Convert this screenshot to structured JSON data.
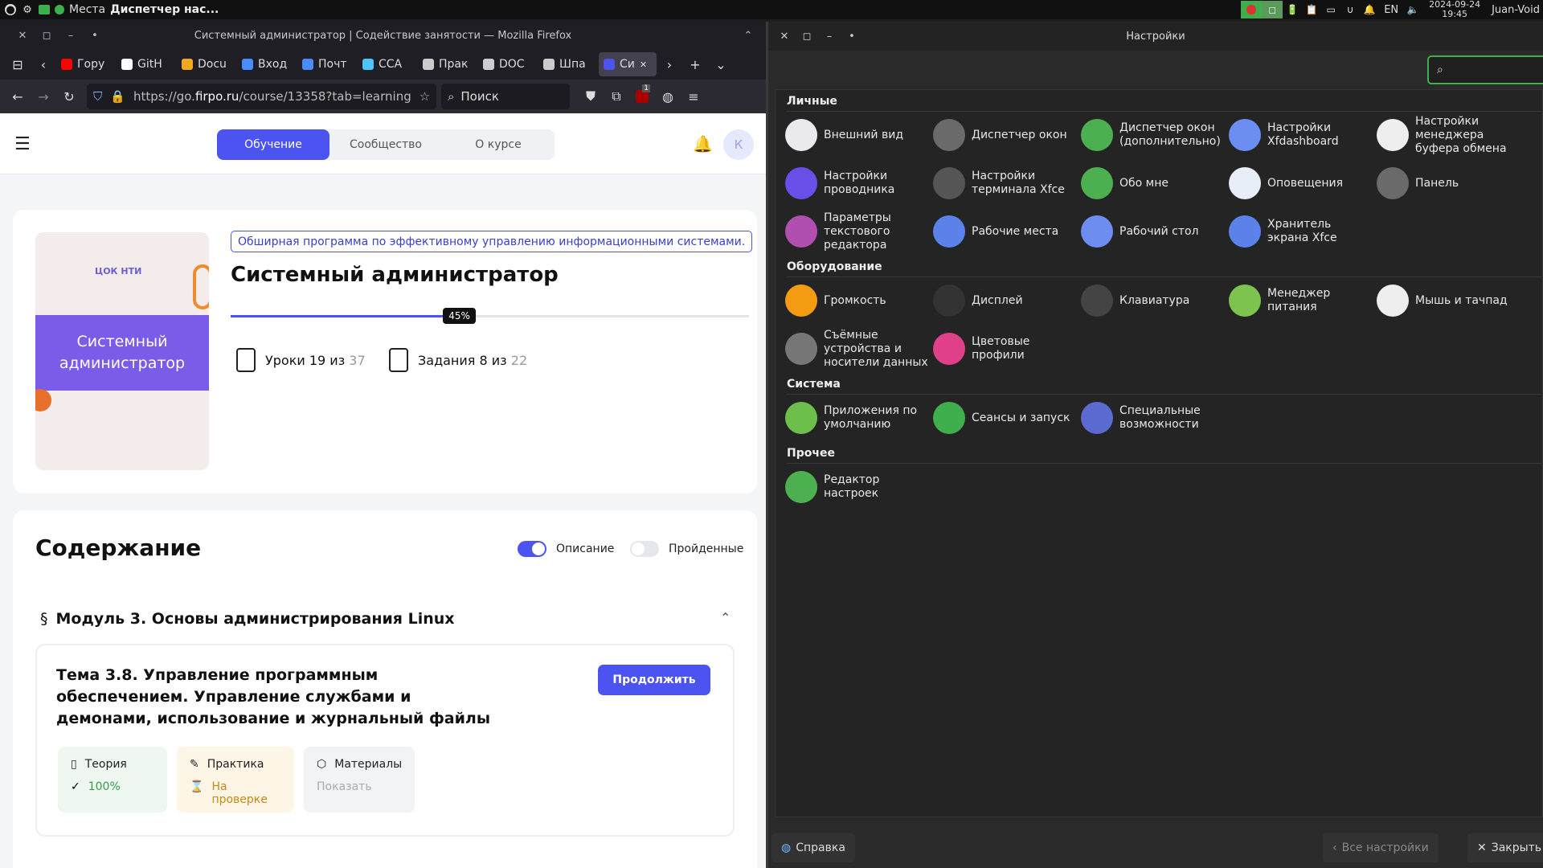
{
  "panel": {
    "places": "Места",
    "taskbar_item": "Диспетчер нас...",
    "lang": "EN",
    "date": "2024-09-24",
    "time": "19:45",
    "user": "Juan-Void"
  },
  "firefox": {
    "window_title": "Системный администратор | Содействие занятости — Mozilla Firefox",
    "tabs": [
      {
        "label": "Гору",
        "icon": "youtube-icon",
        "color": "#ff0000"
      },
      {
        "label": "GitH",
        "icon": "github-icon",
        "color": "#ffffff"
      },
      {
        "label": "Docu",
        "icon": "docs-icon",
        "color": "#f5a623"
      },
      {
        "label": "Вход",
        "icon": "mail-icon",
        "color": "#4a8cff"
      },
      {
        "label": "Почт",
        "icon": "mail-icon",
        "color": "#4a8cff"
      },
      {
        "label": "CCA",
        "icon": "network-icon",
        "color": "#4fc3f7"
      },
      {
        "label": "Прак",
        "icon": "page-icon",
        "color": "#cccccc"
      },
      {
        "label": "DOC",
        "icon": "page-icon",
        "color": "#cccccc"
      },
      {
        "label": "Шпа",
        "icon": "page-icon",
        "color": "#cccccc"
      },
      {
        "label": "Си",
        "icon": "course-icon",
        "color": "#4b53f1"
      }
    ],
    "url_prefix": "https://go.",
    "url_host": "firpo.ru",
    "url_path": "/course/13358?tab=learning",
    "search_placeholder": "Поиск",
    "ublock_badge": "1"
  },
  "page": {
    "nav_tabs": [
      "Обучение",
      "Сообщество",
      "О курсе"
    ],
    "avatar_letter": "К",
    "tag": "Обширная программа по эффективному управлению информационными системами.",
    "course_title": "Системный администратор",
    "thumb_logo": "ЦОК НТИ",
    "thumb_title": "Системный администратор",
    "progress_percent": 45,
    "progress_label": "45%",
    "lessons_label": "Уроки 19 из",
    "lessons_total": "37",
    "tasks_label": "Задания 8 из",
    "tasks_total": "22",
    "contents_title": "Содержание",
    "toggle_description": "Описание",
    "toggle_completed": "Пройденные",
    "module_mark": "§",
    "module_title": "Модуль 3. Основы администрирования Linux",
    "topic_title": "Тема 3.8. Управление программным обеспечением. Управление службами и демонами, использование и журнальный файлы",
    "continue_btn": "Продолжить",
    "chips": [
      {
        "title": "Теория",
        "status": "100%",
        "bg": "#eef8f0",
        "status_color": "#2e9e4a"
      },
      {
        "title": "Практика",
        "status": "На проверке",
        "bg": "#fdf5e6",
        "status_color": "#c98a12"
      },
      {
        "title": "Материалы",
        "status": "Показать",
        "bg": "#f2f3f5",
        "status_color": "#aaaaaa"
      }
    ]
  },
  "settings": {
    "title": "Настройки",
    "categories": [
      {
        "name": "Личные",
        "items": [
          {
            "label": "Внешний вид",
            "icon": "appearance-icon",
            "color": "#e9e9ee"
          },
          {
            "label": "Диспетчер окон",
            "icon": "window-manager-icon",
            "color": "#6a6a6a"
          },
          {
            "label": "Диспетчер окон (дополнительно)",
            "icon": "window-manager-tweaks-icon",
            "color": "#4caf50"
          },
          {
            "label": "Настройки Xfdashboard",
            "icon": "xfdashboard-icon",
            "color": "#6b8ef0"
          },
          {
            "label": "Настройки менеджера буфера обмена",
            "icon": "clipboard-icon",
            "color": "#eeeeee"
          },
          {
            "label": "Настройки проводника",
            "icon": "file-manager-icon",
            "color": "#6a4ee8"
          },
          {
            "label": "Настройки терминала Xfce",
            "icon": "terminal-icon",
            "color": "#555555"
          },
          {
            "label": "Обо мне",
            "icon": "about-me-icon",
            "color": "#4caf50"
          },
          {
            "label": "Оповещения",
            "icon": "notifications-icon",
            "color": "#e8eef8"
          },
          {
            "label": "Панель",
            "icon": "panel-icon",
            "color": "#6a6a6a"
          },
          {
            "label": "Параметры текстового редактора",
            "icon": "text-editor-icon",
            "color": "#b04fb0"
          },
          {
            "label": "Рабочие места",
            "icon": "workspaces-icon",
            "color": "#5b82e8"
          },
          {
            "label": "Рабочий стол",
            "icon": "desktop-icon",
            "color": "#6b8ef0"
          },
          {
            "label": "Хранитель экрана Xfce",
            "icon": "screensaver-icon",
            "color": "#5b82e8"
          }
        ]
      },
      {
        "name": "Оборудование",
        "items": [
          {
            "label": "Громкость",
            "icon": "volume-icon",
            "color": "#f39c12"
          },
          {
            "label": "Дисплей",
            "icon": "display-icon",
            "color": "#333333"
          },
          {
            "label": "Клавиатура",
            "icon": "keyboard-icon",
            "color": "#444444"
          },
          {
            "label": "Менеджер питания",
            "icon": "power-manager-icon",
            "color": "#7cc44e"
          },
          {
            "label": "Мышь и тачпад",
            "icon": "mouse-icon",
            "color": "#eeeeee"
          },
          {
            "label": "Съёмные устройства и носители данных",
            "icon": "removable-drives-icon",
            "color": "#777777"
          },
          {
            "label": "Цветовые профили",
            "icon": "color-profiles-icon",
            "color": "#e0408a"
          }
        ]
      },
      {
        "name": "Система",
        "items": [
          {
            "label": "Приложения по умолчанию",
            "icon": "default-apps-icon",
            "color": "#6cbf4a"
          },
          {
            "label": "Сеансы и запуск",
            "icon": "session-icon",
            "color": "#3fae4c"
          },
          {
            "label": "Специальные возможности",
            "icon": "accessibility-icon",
            "color": "#5b6ad0"
          }
        ]
      },
      {
        "name": "Прочее",
        "items": [
          {
            "label": "Редактор настроек",
            "icon": "settings-editor-icon",
            "color": "#4caf50"
          }
        ]
      }
    ],
    "help_btn": "Справка",
    "all_settings_btn": "Все настройки",
    "close_btn": "Закрыть"
  }
}
